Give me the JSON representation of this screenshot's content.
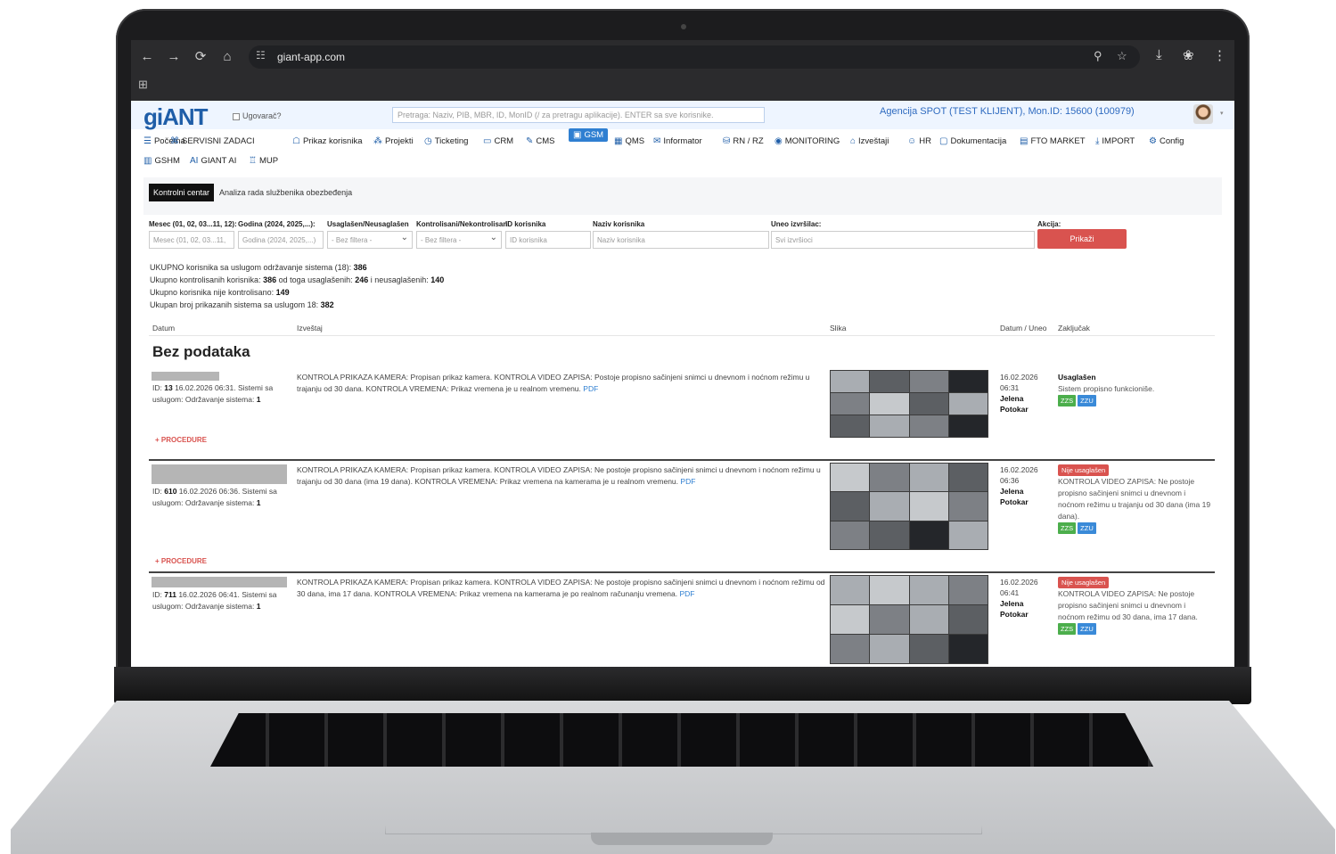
{
  "browser": {
    "url": "giant-app.com",
    "back_icon": "←",
    "forward_icon": "→",
    "reload_icon": "⟳",
    "home_icon": "⌂",
    "site_info_icon": "☷",
    "zoom_icon": "⚲",
    "star_icon": "☆",
    "download_icon": "⤓",
    "profile_icon": "❀",
    "menu_icon": "⋮",
    "apps_icon": "⊞"
  },
  "header": {
    "logo": "giANT",
    "ugovarac_label": "Ugovarač?",
    "search_placeholder": "Pretraga: Naziv, PIB, MBR, ID, MonID (/ za pretragu aplikacije). ENTER sa sve korisnike.",
    "agency": "Agencija SPOT (TEST KLIJENT), Mon.ID: 15600 (100979)"
  },
  "menu": {
    "items": [
      {
        "icon": "☰",
        "label": "Početna"
      },
      {
        "icon": "⌘",
        "label": "SERVISNI ZADACI"
      },
      {
        "icon": "☖",
        "label": "Prikaz korisnika"
      },
      {
        "icon": "⁂",
        "label": "Projekti"
      },
      {
        "icon": "◷",
        "label": "Ticketing"
      },
      {
        "icon": "▭",
        "label": "CRM"
      },
      {
        "icon": "✎",
        "label": "CMS"
      },
      {
        "icon": "▣",
        "label": "GSM"
      },
      {
        "icon": "▦",
        "label": "QMS"
      },
      {
        "icon": "✉",
        "label": "Informator"
      },
      {
        "icon": "⛁",
        "label": "RN / RZ"
      },
      {
        "icon": "◉",
        "label": "MONITORING"
      },
      {
        "icon": "⌂",
        "label": "Izveštaji"
      },
      {
        "icon": "☺",
        "label": "HR"
      },
      {
        "icon": "▢",
        "label": "Dokumentacija"
      },
      {
        "icon": "▤",
        "label": "FTO MARKET"
      },
      {
        "icon": "⤓",
        "label": "IMPORT"
      },
      {
        "icon": "⚙",
        "label": "Config"
      },
      {
        "icon": "▥",
        "label": "GSHM"
      },
      {
        "icon": "AI",
        "label": "GIANT AI"
      },
      {
        "icon": "♖",
        "label": "MUP"
      }
    ],
    "active": "GSM"
  },
  "tabs": [
    "Kontrolni centar",
    "Analiza rada službenika obezbeđenja"
  ],
  "filters": {
    "mesec_label": "Mesec (01, 02, 03...11, 12):",
    "mesec_placeholder": "Mesec (01, 02, 03...11,",
    "godina_label": "Godina (2024, 2025,...):",
    "godina_placeholder": "Godina (2024, 2025,...)",
    "usaglasen_label": "Usaglašen/Neusaglašen",
    "usaglasen_value": "- Bez filtera -",
    "kontrolisani_label": "Kontrolisani/Nekontrolisani",
    "kontrolisani_value": "- Bez filtera -",
    "id_label": "ID korisnika",
    "id_placeholder": "ID korisnika",
    "naziv_label": "Naziv korisnika",
    "naziv_placeholder": "Naziv korisnika",
    "uneo_label": "Uneo izvršilac:",
    "uneo_value": "Svi izvršioci",
    "akcija_label": "Akcija:",
    "button": "Prikaži"
  },
  "stats": {
    "line1_text": "UKUPNO korisnika sa uslugom održavanje sistema (18): ",
    "line1_value": "386",
    "line2_text": "Ukupno kontrolisanih korisnika: ",
    "line2_value": "386",
    "line2_mid": " od toga usaglašenih: ",
    "line2_ok": "246",
    "line2_mid2": " i neusaglašenih: ",
    "line2_bad": "140",
    "line3_text": "Ukupno korisnika nije kontrolisano: ",
    "line3_value": "149",
    "line4_text": "Ukupan broj prikazanih sistema sa uslugom 18: ",
    "line4_value": "382"
  },
  "table": {
    "headers": [
      "Datum",
      "Izveštaj",
      "Slika",
      "Datum / Uneo",
      "Zaključak"
    ],
    "no_data": "Bez podataka",
    "procedure_label": "+ PROCEDURE",
    "rows": [
      {
        "id": "13",
        "meta_rest": " 16.02.2026 06:31. Sistemi sa uslugom: Održavanje sistema: ",
        "count": "1",
        "report": "KONTROLA PRIKAZA KAMERA: Propisan prikaz kamera. KONTROLA VIDEO ZAPISA: Postoje propisno sačinjeni snimci u dnevnom i noćnom režimu u trajanju od 30 dana. KONTROLA VREMENA: Prikaz vremena je u realnom vremenu.",
        "pdf": "PDF",
        "date": "16.02.2026",
        "time": "06:31",
        "user": "Jelena Potokar",
        "status": "Usaglašen",
        "status_type": "ok",
        "conclusion": "Sistem propisno funkcioniše.",
        "tags": [
          "ZZS",
          "ZZU"
        ]
      },
      {
        "id": "610",
        "meta_rest": " 16.02.2026 06:36. Sistemi sa uslugom: Održavanje sistema: ",
        "count": "1",
        "report": "KONTROLA PRIKAZA KAMERA: Propisan prikaz kamera. KONTROLA VIDEO ZAPISA: Ne postoje propisno sačinjeni snimci u dnevnom i noćnom režimu u trajanju od 30 dana (ima 19 dana). KONTROLA VREMENA: Prikaz vremena na kamerama je u realnom vremenu.",
        "pdf": "PDF",
        "date": "16.02.2026",
        "time": "06:36",
        "user": "Jelena Potokar",
        "status": "Nije usaglašen",
        "status_type": "bad",
        "conclusion": "KONTROLA VIDEO ZAPISA: Ne postoje propisno sačinjeni snimci u dnevnom i noćnom režimu u trajanju od 30 dana (ima 19 dana).",
        "tags": [
          "ZZS",
          "ZZU"
        ]
      },
      {
        "id": "711",
        "meta_rest": " 16.02.2026 06:41. Sistemi sa uslugom: Održavanje sistema: ",
        "count": "1",
        "report": "KONTROLA PRIKAZA KAMERA: Propisan prikaz kamera. KONTROLA VIDEO ZAPISA: Ne postoje propisno sačinjeni snimci u dnevnom i noćnom režimu od 30 dana, ima 17 dana. KONTROLA VREMENA: Prikaz vremena na kamerama je po realnom računanju vremena.",
        "pdf": "PDF",
        "date": "16.02.2026",
        "time": "06:41",
        "user": "Jelena Potokar",
        "status": "Nije usaglašen",
        "status_type": "bad",
        "conclusion": "KONTROLA VIDEO ZAPISA: Ne postoje propisno sačinjeni snimci u dnevnom i noćnom režimu od 30 dana, ima 17 dana.",
        "tags": [
          "ZZS",
          "ZZU"
        ]
      }
    ]
  },
  "colors": {
    "accent": "#2f7fd1",
    "danger": "#d9534f",
    "success": "#4cae4c"
  }
}
